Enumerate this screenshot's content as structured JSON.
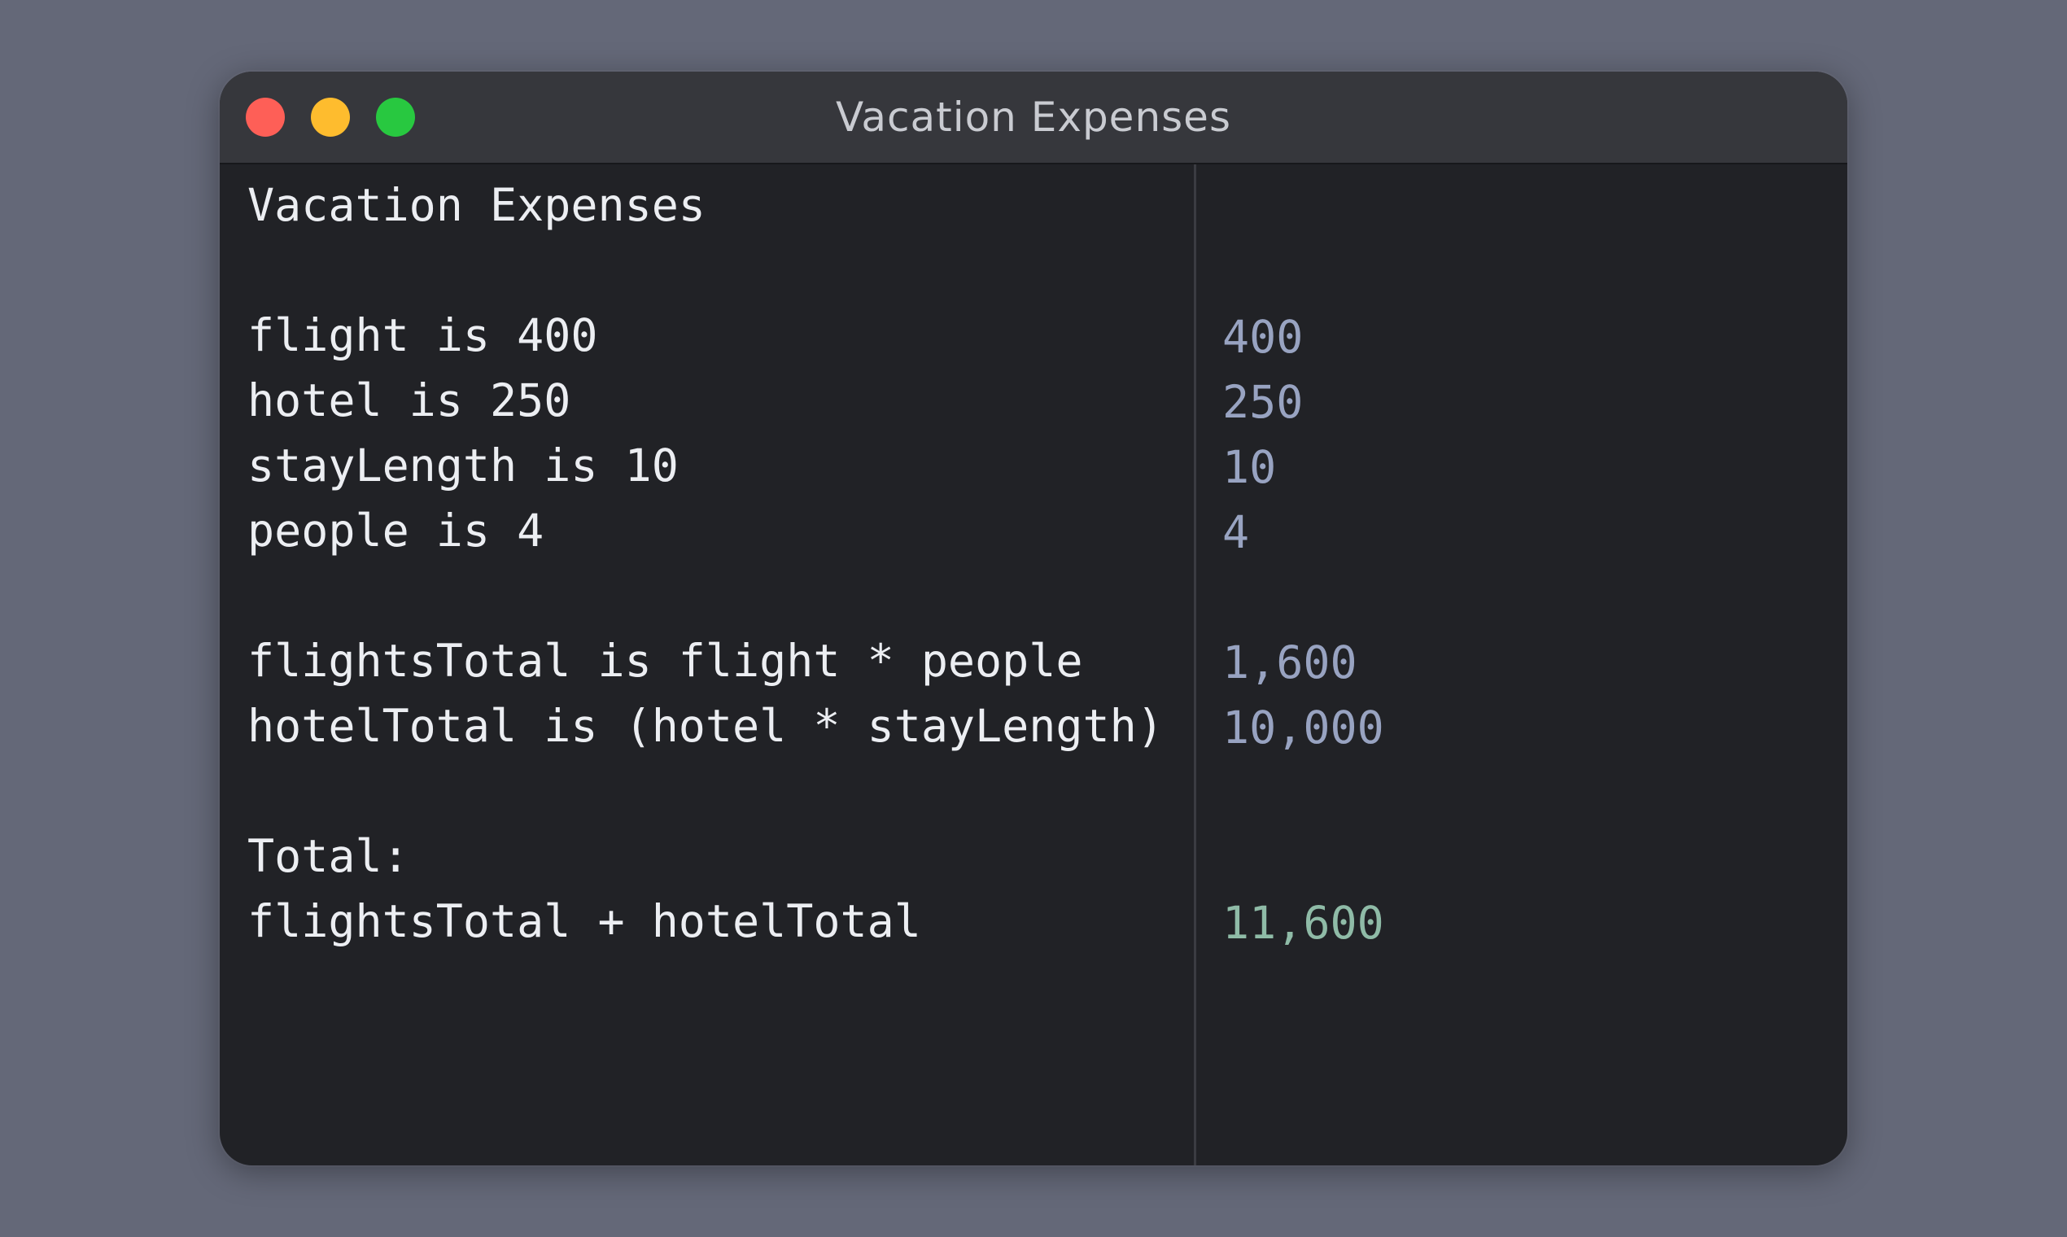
{
  "window": {
    "title": "Vacation Expenses",
    "colors": {
      "desktop_background": "#646878",
      "window_background": "#212226",
      "titlebar_background": "#36373c",
      "close_button": "#fe5f57",
      "minimize_button": "#febc2e",
      "zoom_button": "#28c840",
      "expression_text": "#eceef2",
      "result_text": "#98a3c1",
      "total_result_text": "#8fbba7"
    }
  },
  "editor": {
    "lines": [
      {
        "text": "Vacation Expenses"
      },
      {
        "text": ""
      },
      {
        "text": "flight is 400",
        "result": "400"
      },
      {
        "text": "hotel is 250",
        "result": "250"
      },
      {
        "text": "stayLength is 10",
        "result": "10"
      },
      {
        "text": "people is 4",
        "result": "4"
      },
      {
        "text": ""
      },
      {
        "text": "flightsTotal is flight * people",
        "result": "1,600"
      },
      {
        "text": "hotelTotal is (hotel * stayLength)",
        "result": "10,000"
      },
      {
        "text": ""
      },
      {
        "text": "Total:"
      },
      {
        "text": "flightsTotal + hotelTotal",
        "result": "11,600"
      }
    ]
  }
}
